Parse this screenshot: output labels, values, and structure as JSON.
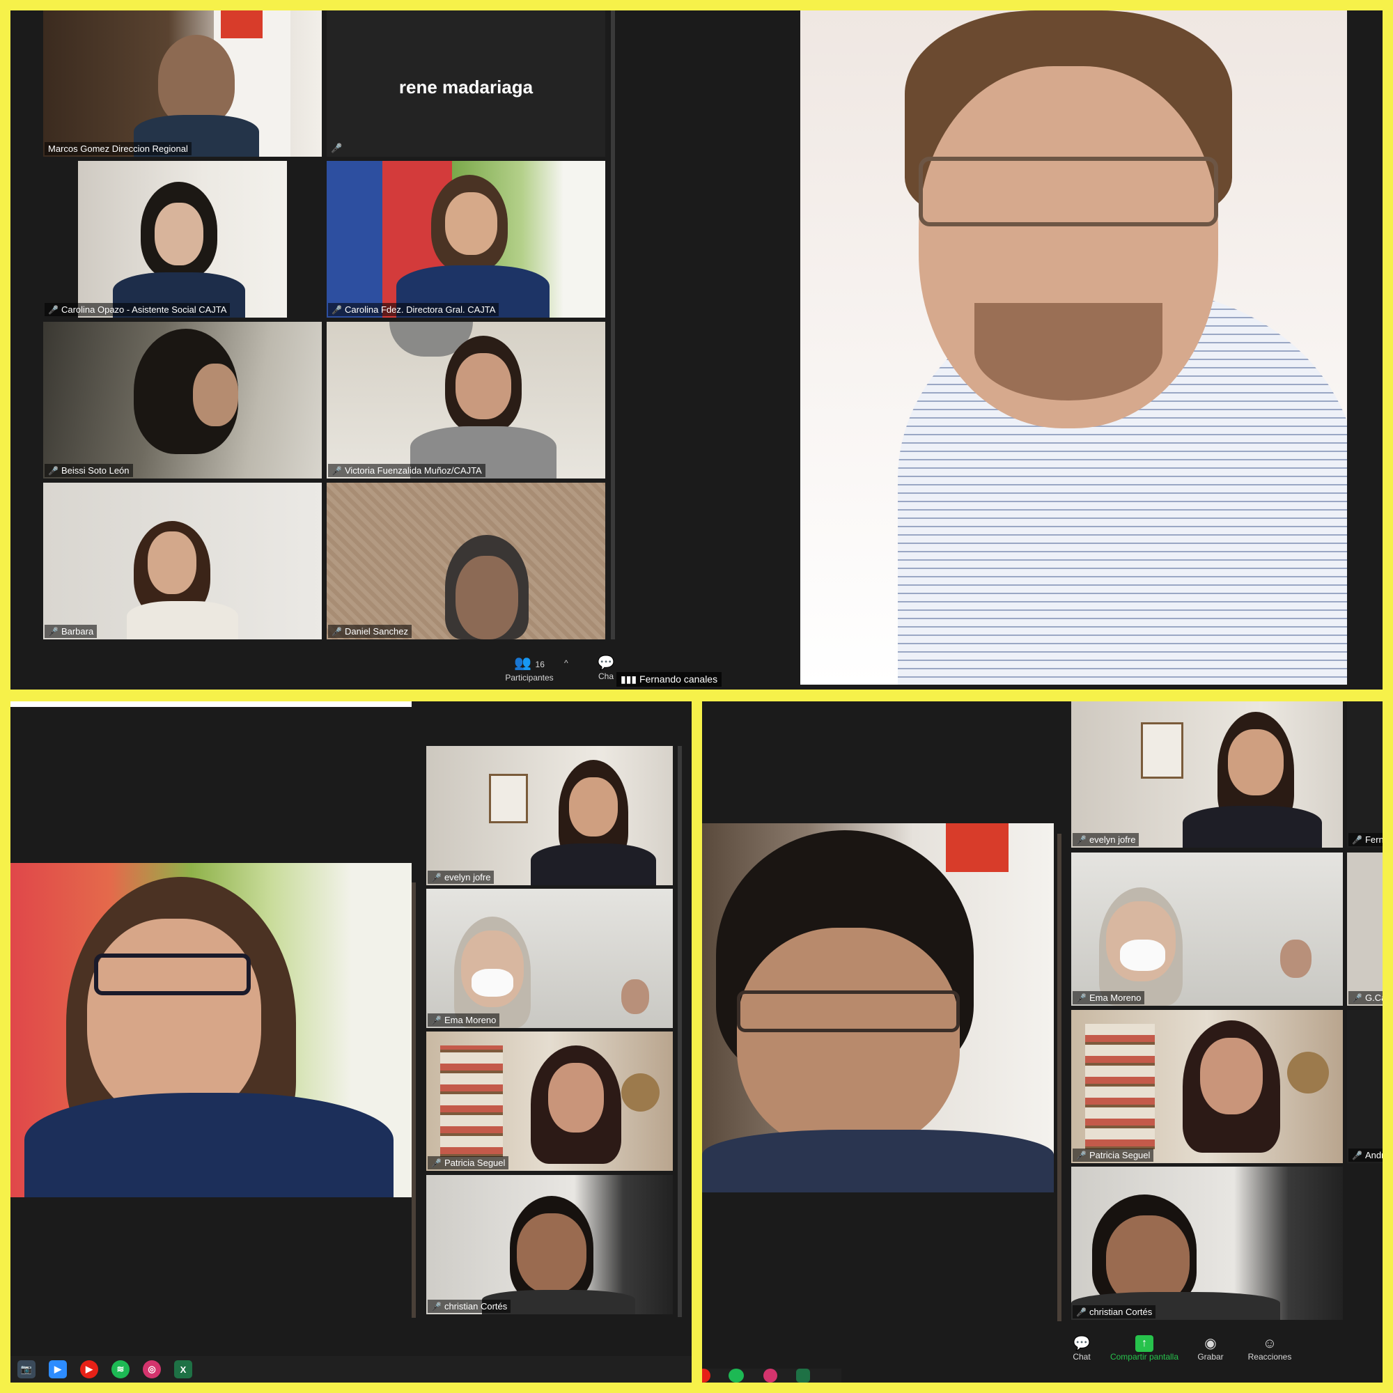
{
  "colors": {
    "frame": "#f6f14a",
    "panel": "#1b1b1b",
    "mic_muted": "#e8343a",
    "share_green": "#27c24c"
  },
  "q1": {
    "tiles": [
      {
        "name": "Marcos Gomez Direccion Regional",
        "muted": false
      },
      {
        "name": "rene madariaga",
        "muted": true,
        "video_off": true
      },
      {
        "name": "Carolina Opazo - Asistente Social CAJTA",
        "muted": true
      },
      {
        "name": "Carolina Fdez. Directora Gral. CAJTA",
        "muted": true
      },
      {
        "name": "Beissi Soto León",
        "muted": true
      },
      {
        "name": "Victoria Fuenzalida Muñoz/CAJTA",
        "muted": true
      },
      {
        "name": "Barbara",
        "muted": true
      },
      {
        "name": "Daniel  Sanchez",
        "muted": true
      }
    ],
    "participants_count": "16",
    "participants_label": "Participantes",
    "chat_label": "Cha",
    "speaker_name": "Fernando canales"
  },
  "q3": {
    "tiles": [
      {
        "name": "evelyn jofre"
      },
      {
        "name": "Ema Moreno"
      },
      {
        "name": "Patricia Seguel"
      },
      {
        "name": "christian Cortés"
      }
    ],
    "taskbar_icons": [
      "camera-icon",
      "zoom-icon",
      "youtube-icon",
      "spotify-icon",
      "media-icon",
      "excel-icon"
    ]
  },
  "q4": {
    "tiles": [
      {
        "name": "evelyn jofre"
      },
      {
        "name": "Ema Moreno"
      },
      {
        "name": "Patricia Seguel"
      },
      {
        "name": "christian Cortés"
      }
    ],
    "side_names": [
      "Ferna",
      "G.Ca",
      "Andr"
    ],
    "toolbar": [
      {
        "label": "Chat",
        "icon": "chat-icon"
      },
      {
        "label": "Compartir pantalla",
        "icon": "share-screen-icon"
      },
      {
        "label": "Grabar",
        "icon": "record-icon"
      },
      {
        "label": "Reacciones",
        "icon": "reactions-icon"
      }
    ]
  }
}
